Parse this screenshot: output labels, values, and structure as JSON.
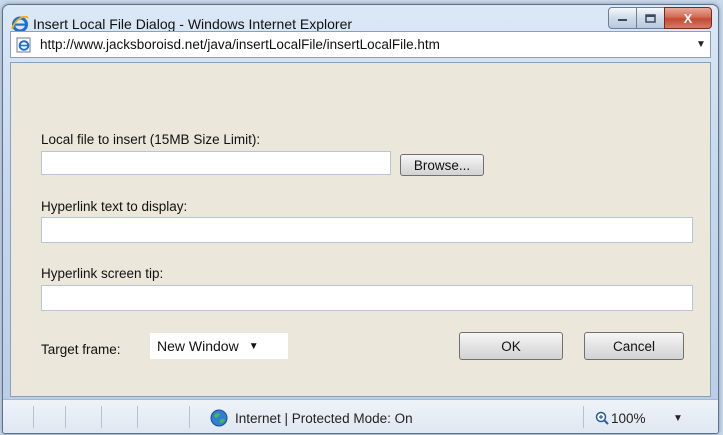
{
  "window": {
    "title": "Insert Local File Dialog - Windows Internet Explorer",
    "icon": "ie-logo-icon",
    "controls": {
      "minimize": "minimize-icon",
      "maximize": "maximize-icon",
      "close": "X"
    }
  },
  "address": {
    "url": "http://www.jacksboroisd.net/java/insertLocalFile/insertLocalFile.htm",
    "dropdown": "▼"
  },
  "form": {
    "file_label": "Local file to insert (15MB Size Limit):",
    "file_value": "",
    "browse_label": "Browse...",
    "link_text_label": "Hyperlink text to display:",
    "link_text_value": "",
    "screen_tip_label": "Hyperlink screen tip:",
    "screen_tip_value": "",
    "target_label": "Target frame:",
    "target_value": "New Window",
    "ok_label": "OK",
    "cancel_label": "Cancel"
  },
  "status": {
    "zone": "Internet | Protected Mode: On",
    "zoom": "100%",
    "zoom_drop": "▼"
  }
}
